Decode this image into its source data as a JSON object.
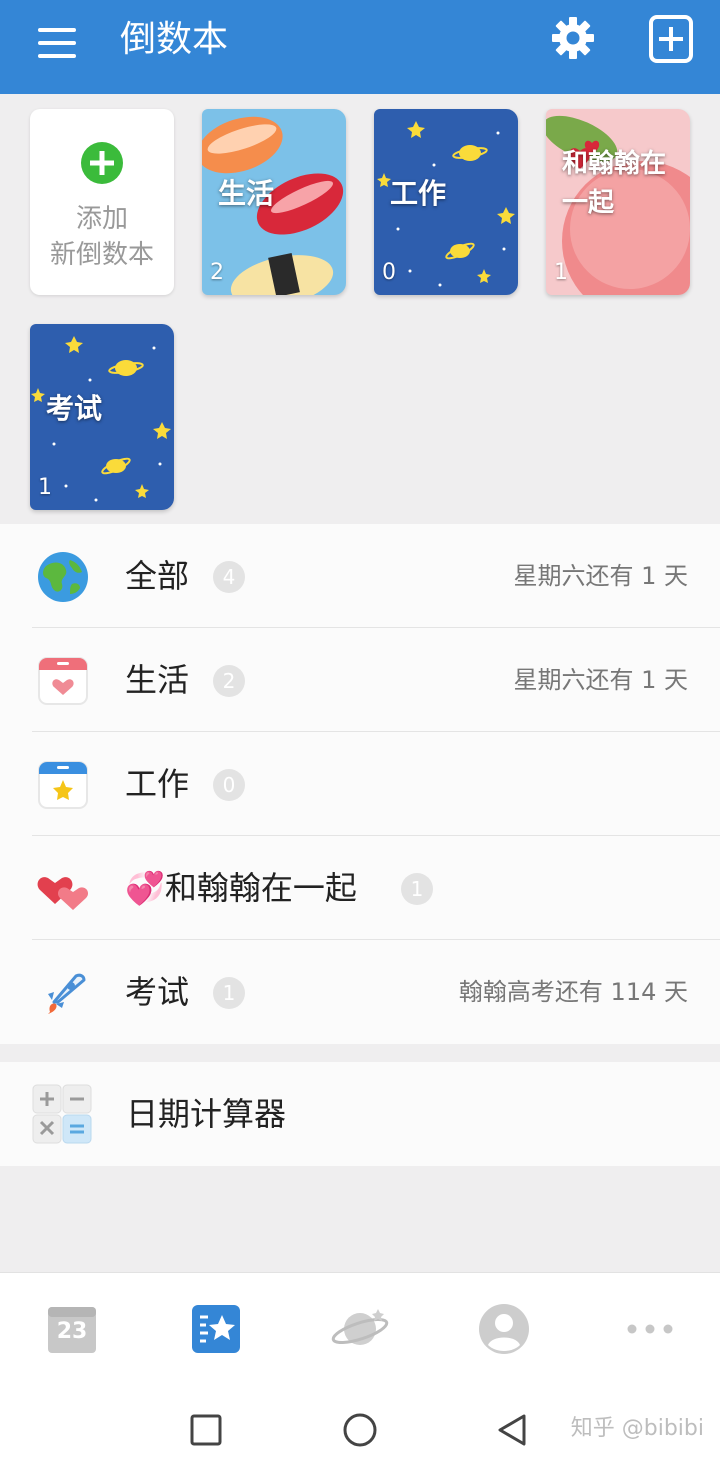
{
  "app": {
    "title": "倒数本"
  },
  "toolbar": {
    "menu_icon": "hamburger-menu-icon",
    "settings_icon": "gear-icon",
    "add_icon": "add-book-icon"
  },
  "books": {
    "add": {
      "line1": "添加",
      "line2": "新倒数本"
    },
    "items": [
      {
        "name": "生活",
        "count": "2",
        "theme": "sushi"
      },
      {
        "name": "工作",
        "count": "0",
        "theme": "space"
      },
      {
        "name": "和翰翰在一起",
        "count": "1",
        "theme": "peach"
      },
      {
        "name": "考试",
        "count": "1",
        "theme": "space"
      }
    ]
  },
  "categories": [
    {
      "name": "全部",
      "count": "4",
      "note": "星期六还有 1 天",
      "icon": "globe-icon"
    },
    {
      "name": "生活",
      "count": "2",
      "note": "星期六还有 1 天",
      "icon": "calendar-heart-icon"
    },
    {
      "name": "工作",
      "count": "0",
      "note": "",
      "icon": "calendar-star-icon"
    },
    {
      "name": "💞和翰翰在一起",
      "count": "1",
      "note": "",
      "icon": "two-hearts-icon"
    },
    {
      "name": "考试",
      "count": "1",
      "note": "翰翰高考还有 114 天",
      "icon": "rocket-icon"
    }
  ],
  "tools": {
    "date_calculator": "日期计算器"
  },
  "bottom_nav": {
    "calendar_day": "23",
    "tabs": [
      "calendar-icon",
      "countdown-books-icon",
      "planet-icon",
      "profile-icon",
      "more-icon"
    ],
    "active": 1
  },
  "system_nav": {
    "watermark": "知乎 @bibibi"
  },
  "colors": {
    "primary": "#3486d6",
    "accent_green": "#3bbb3b",
    "badge": "#e3e3e3"
  }
}
